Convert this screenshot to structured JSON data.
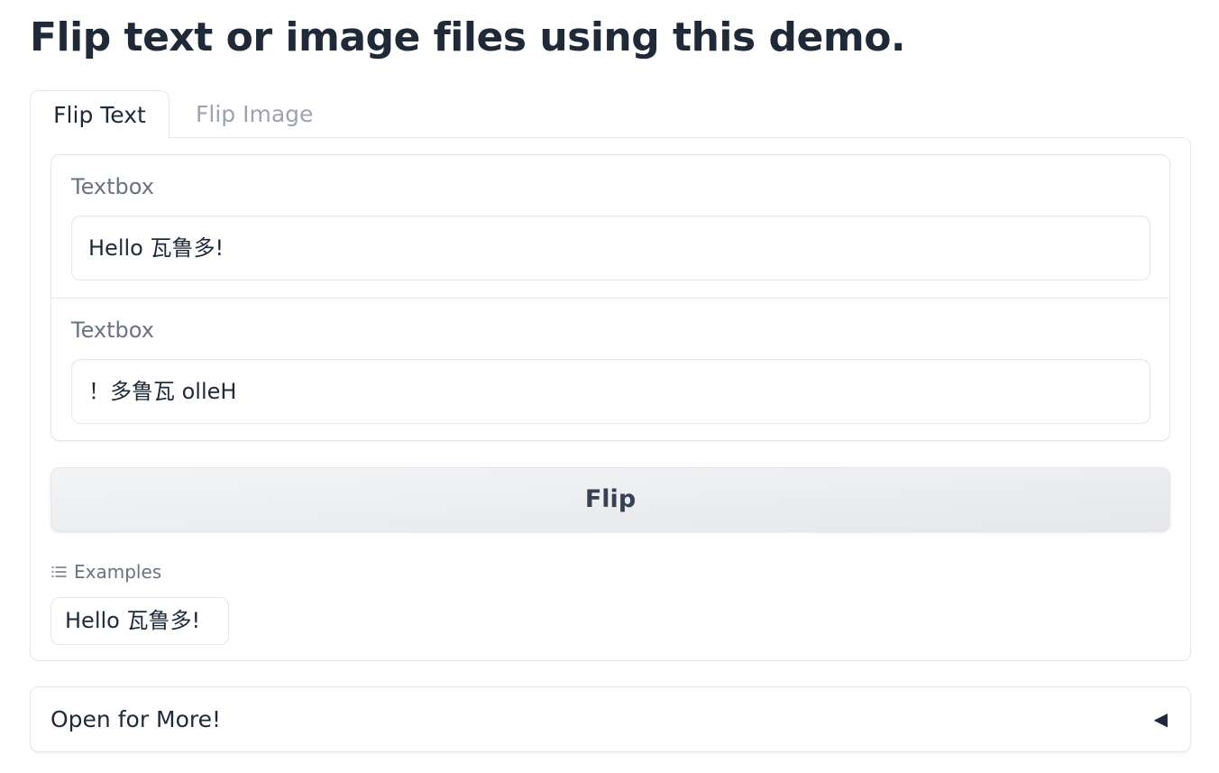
{
  "title": "Flip text or image files using this demo.",
  "tabs": [
    {
      "label": "Flip Text",
      "active": true
    },
    {
      "label": "Flip Image",
      "active": false
    }
  ],
  "inputs": {
    "input_label": "Textbox",
    "input_value": "Hello 瓦鲁多!",
    "output_label": "Textbox",
    "output_value": "！多鲁瓦 olleH"
  },
  "flip_button": {
    "label": "Flip"
  },
  "examples": {
    "header": "Examples",
    "icon": "list-icon",
    "items": [
      "Hello 瓦鲁多!"
    ]
  },
  "accordion": {
    "label": "Open for More!",
    "arrow": "◀",
    "icon": "collapse-arrow-icon"
  },
  "colors": {
    "text": "#1f2937",
    "muted": "#6b7280",
    "inactive_tab": "#9ca3af",
    "border": "#e5e7eb",
    "button_bg": "#f3f4f6"
  }
}
